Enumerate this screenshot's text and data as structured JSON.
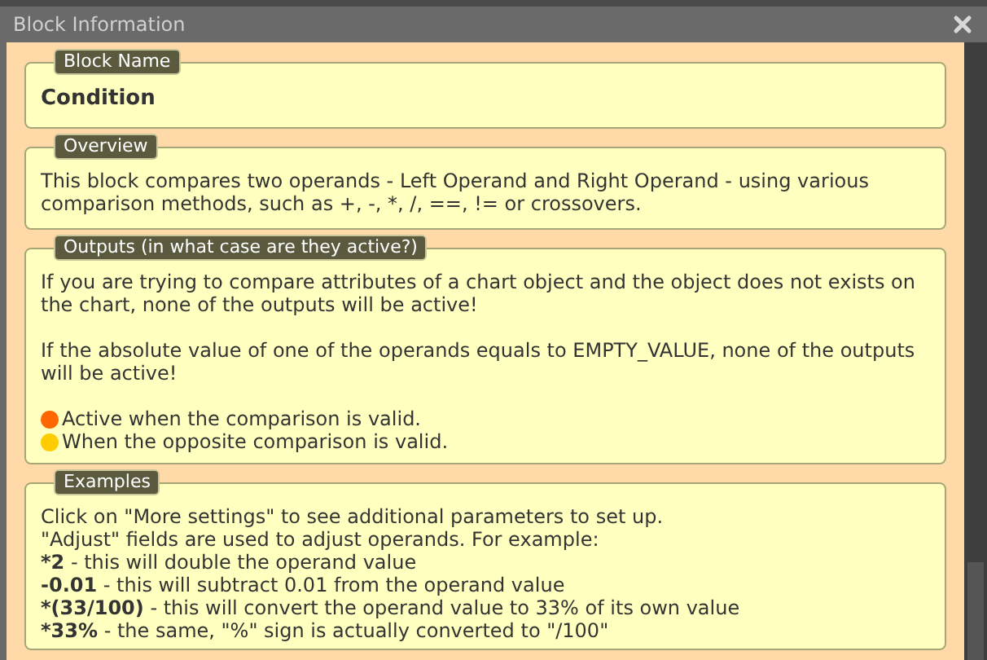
{
  "window": {
    "title": "Block Information"
  },
  "sections": [
    {
      "kind": "text",
      "legend": "Block Name",
      "paragraphs": [
        "**Condition**"
      ]
    },
    {
      "kind": "text",
      "legend": "Overview",
      "paragraphs": [
        "This block compares two operands - Left Operand and Right Operand - using various comparison methods, such as +, -, *, /, ==, != or crossovers."
      ]
    },
    {
      "kind": "outputs",
      "legend": "Outputs (in what case are they active?)",
      "paragraphs": [
        "If you are trying to compare attributes of a chart object and the object does not exists on the chart, none of the outputs will be active!",
        "If the absolute value of one of the operands equals to EMPTY_VALUE, none of the outputs will be active!"
      ],
      "outputs": [
        {
          "color": "#ff6600",
          "text": "Active when the comparison is valid."
        },
        {
          "color": "#ffcc00",
          "text": "When the opposite comparison is valid."
        }
      ]
    },
    {
      "kind": "lines",
      "legend": "Examples",
      "lines": [
        "Click on \"More settings\" to see additional parameters to set up.",
        "\"Adjust\" fields are used to adjust operands. For example:",
        {
          "term": "*2",
          "text": " - this will double the operand value"
        },
        {
          "term": "-0.01",
          "text": " - this will subtract 0.01 from the operand value"
        },
        {
          "term": "*(33/100)",
          "text": " - this will convert the operand value to 33% of its own value"
        },
        {
          "term": "*33%",
          "text": " - the same, \"%\" sign is actually converted to \"/100\""
        }
      ]
    }
  ]
}
